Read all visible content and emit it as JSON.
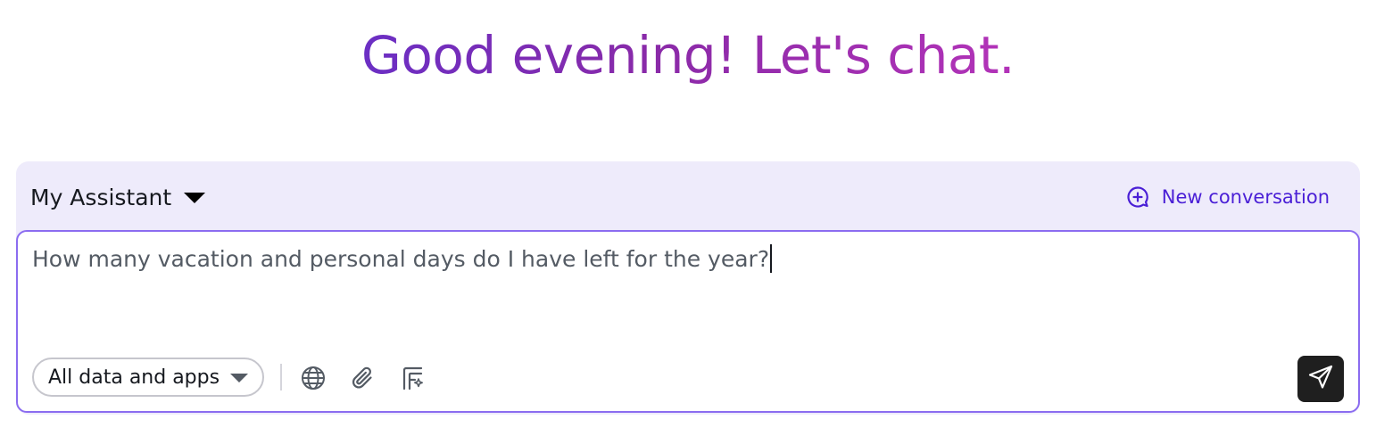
{
  "header": {
    "greeting": "Good evening! Let's chat."
  },
  "assistant_selector": {
    "label": "My Assistant",
    "icon": "caret-down-icon"
  },
  "new_conversation": {
    "label": "New conversation",
    "icon": "chat-plus-icon"
  },
  "composer": {
    "prompt_text": "How many vacation and personal days do I have left for the year?",
    "scope_selector": {
      "label": "All data and apps",
      "icon": "caret-down-icon"
    },
    "tools": [
      {
        "name": "web-search",
        "icon": "globe-icon"
      },
      {
        "name": "attach",
        "icon": "paperclip-icon"
      },
      {
        "name": "prompts",
        "icon": "sparkle-prompt-icon"
      }
    ],
    "send_icon": "send-icon"
  },
  "colors": {
    "greeting_gradient_start": "#6b2fc4",
    "greeting_gradient_end": "#b333b8",
    "panel_background": "#eeebfb",
    "accent": "#4a1fd6",
    "input_border": "#8b6cf0",
    "send_button": "#1f1f1f"
  }
}
